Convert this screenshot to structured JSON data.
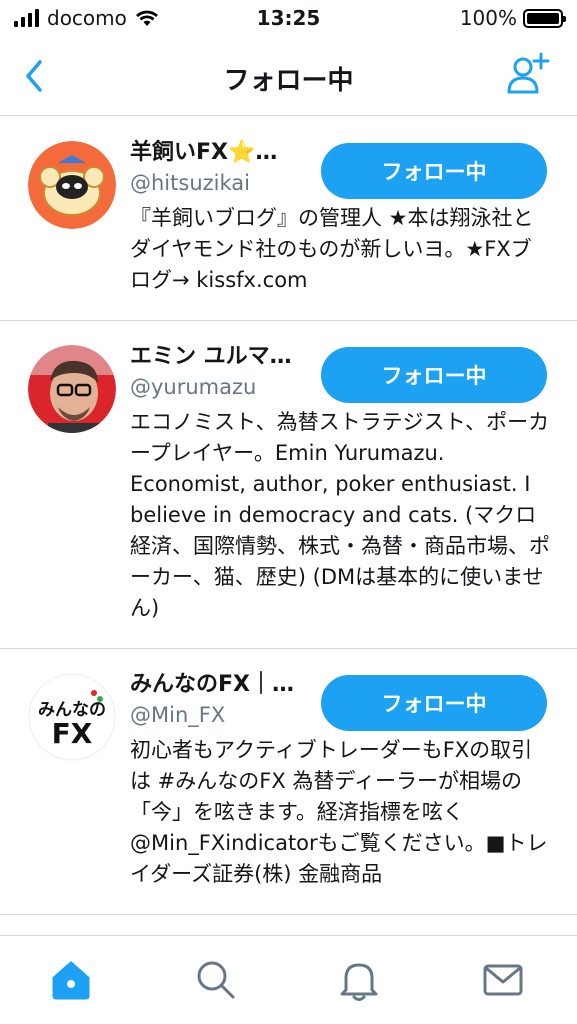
{
  "status_bar": {
    "carrier": "docomo",
    "time": "13:25",
    "battery": "100%"
  },
  "nav": {
    "title": "フォロー中",
    "back_icon": "chevron-left-icon",
    "add_icon": "add-user-icon"
  },
  "colors": {
    "accent": "#1da1f2",
    "secondary_text": "#657786",
    "divider": "#d8d8d8"
  },
  "users": [
    {
      "name": "羊飼いFX⭐…",
      "handle": "@hitsuzikai",
      "bio": "『羊飼いブログ』の管理人 ★本は翔泳社とダイヤモンド社のものが新しいヨ。★FXブログ→ kissfx.com",
      "button": "フォロー中"
    },
    {
      "name": "エミン ユルマ…",
      "handle": "@yurumazu",
      "bio": "エコノミスト、為替ストラテジスト、ポーカープレイヤー。Emin Yurumazu. Economist, author, poker enthusiast. I believe in democracy and cats. (マクロ経済、国際情勢、株式・為替・商品市場、ポーカー、猫、歴史) (DMは基本的に使いません)",
      "button": "フォロー中"
    },
    {
      "name": "みんなのFX｜…",
      "handle": "@Min_FX",
      "bio": "初心者もアクティブトレーダーもFXの取引は #みんなのFX 為替ディーラーが相場の「今」を呟きます。経済指標を呟く@Min_FXindicatorもご覧ください。■トレイダーズ証券(株) 金融商品",
      "button": "フォロー中",
      "avatar_text_top": "みんなの",
      "avatar_text_bottom": "FX"
    }
  ],
  "tabs": [
    {
      "icon": "home-icon",
      "active": true
    },
    {
      "icon": "search-icon",
      "active": false
    },
    {
      "icon": "bell-icon",
      "active": false
    },
    {
      "icon": "mail-icon",
      "active": false
    }
  ]
}
